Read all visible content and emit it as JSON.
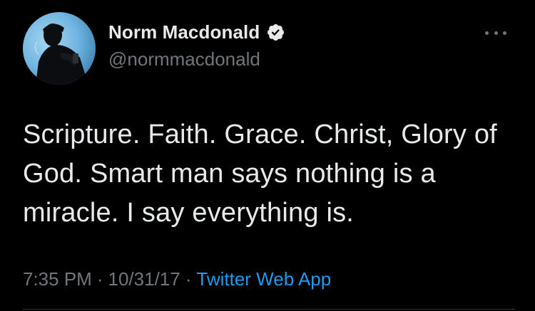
{
  "tweet": {
    "author": {
      "display_name": "Norm Macdonald",
      "handle": "@normmacdonald",
      "verified": true,
      "verified_icon": "verified-badge-icon",
      "avatar_icon": "profile-photo"
    },
    "text": "Scripture. Faith. Grace. Christ, Glory of God. Smart man says nothing is a miracle. I say everything is.",
    "time": "7:35 PM",
    "separator": "·",
    "date": "10/31/17",
    "source": "Twitter Web App",
    "more_icon": "more-options-icon"
  },
  "colors": {
    "background": "#000000",
    "text_primary": "#e7e9ea",
    "text_secondary": "#71767b",
    "accent": "#1d9bf0",
    "avatar_sky": "#6fb4e0"
  }
}
